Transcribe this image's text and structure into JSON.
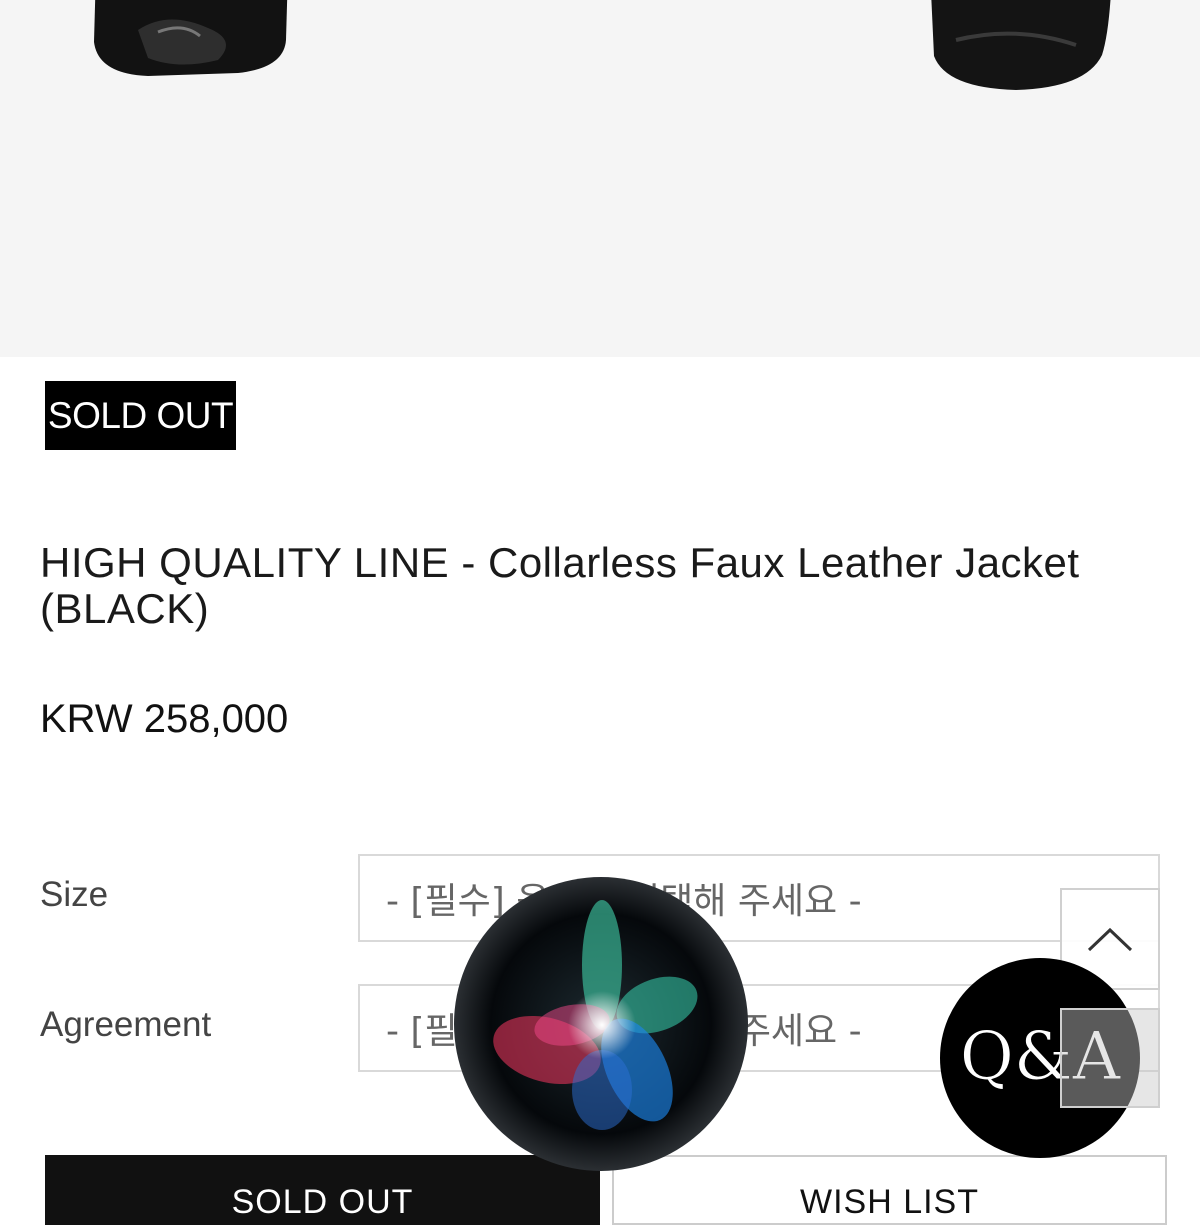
{
  "product": {
    "sold_out_badge": "SOLD OUT",
    "title": "HIGH QUALITY LINE - Collarless Faux Leather Jacket (BLACK)",
    "price": "KRW 258,000"
  },
  "options": [
    {
      "label": "Size",
      "placeholder": "- [필수] 옵션을 선택해 주세요 -"
    },
    {
      "label": "Agreement",
      "placeholder": "- [필수] 옵션을 선택해 주세요 -"
    }
  ],
  "actions": {
    "sold_out_label": "SOLD OUT",
    "wishlist_label": "WISH LIST"
  },
  "floating": {
    "qna_label": "Q&A",
    "scroll_top_icon": "chevron-up-icon",
    "siri_icon": "siri-orb-icon"
  },
  "colors": {
    "hero_background": "#f5f5f5",
    "badge_background": "#000000",
    "sold_out_button": "#111111"
  }
}
